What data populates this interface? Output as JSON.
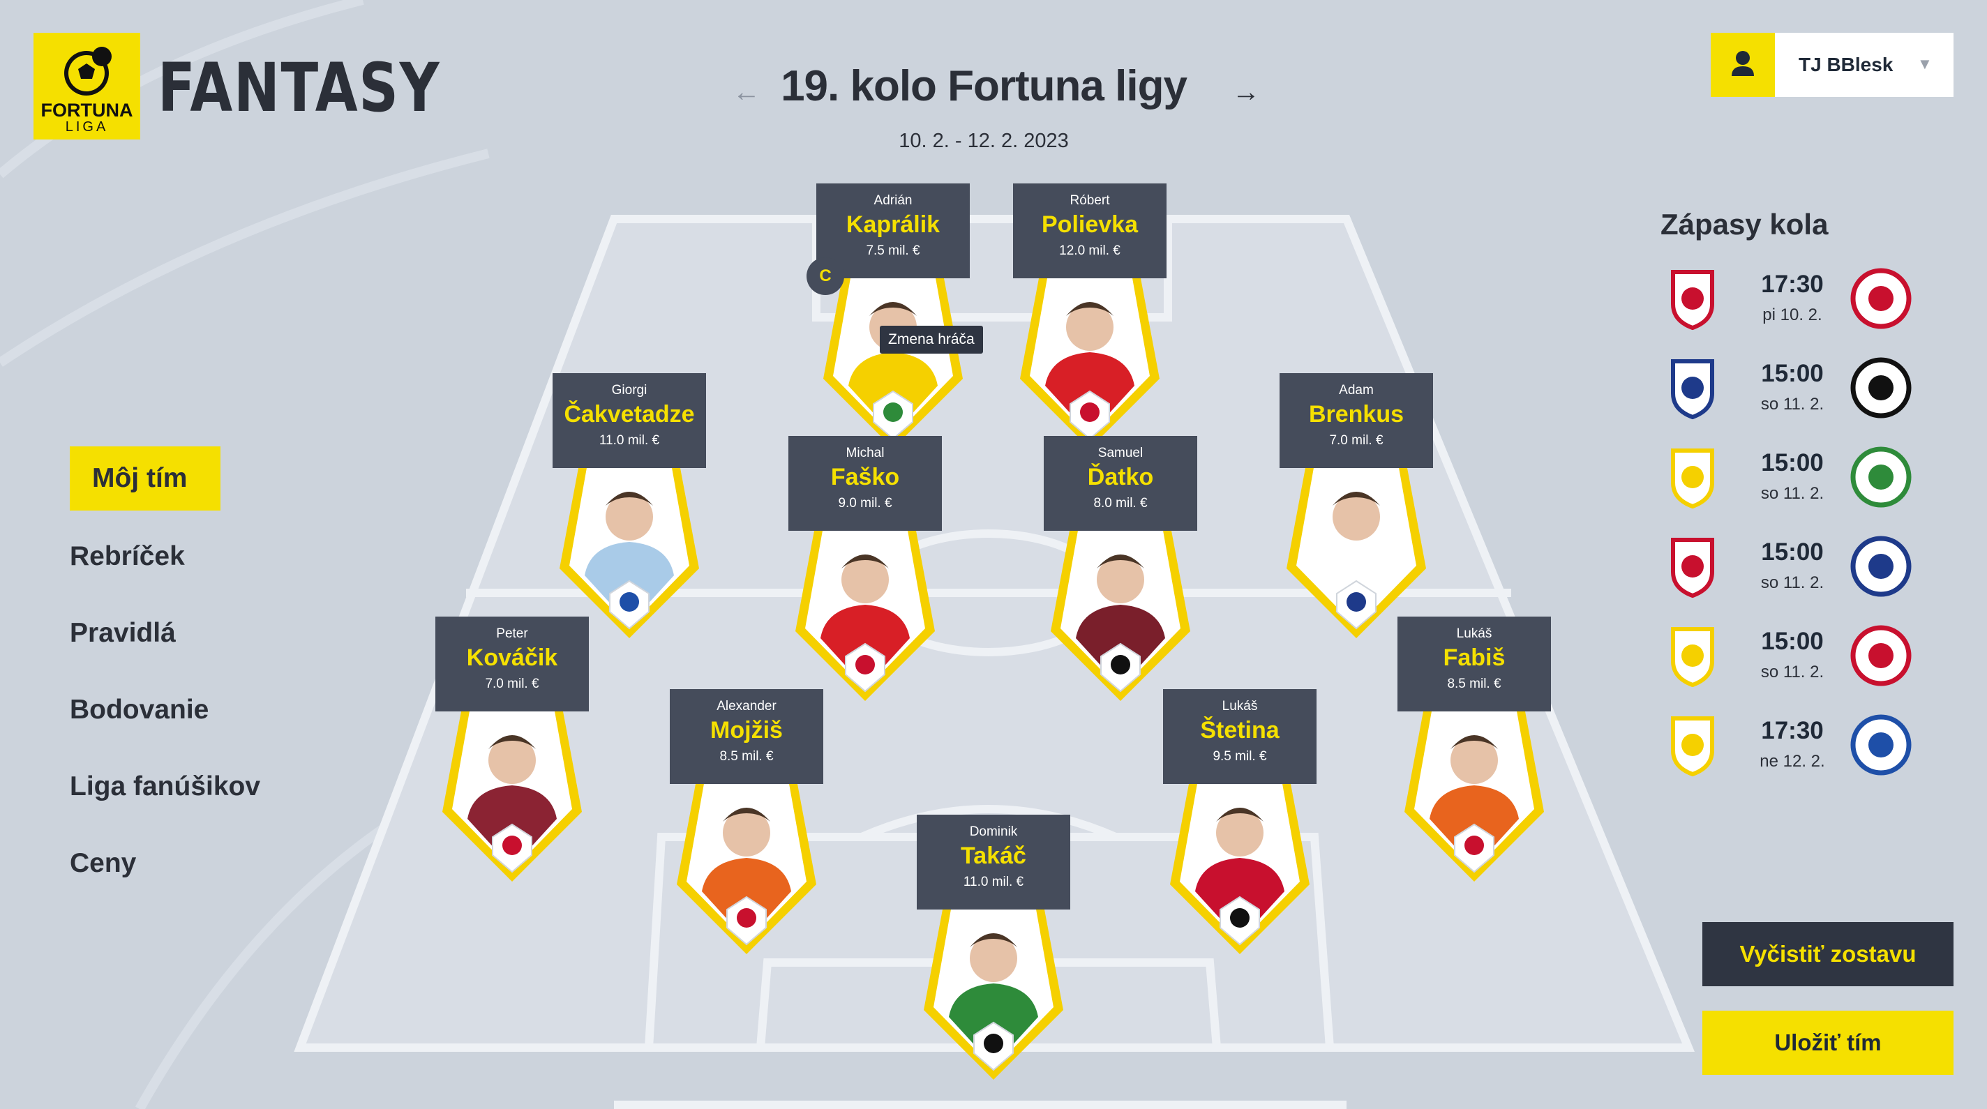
{
  "brand": {
    "logo_line1": "FORTUNA",
    "logo_line2": "LIGA",
    "product": "FANTASY",
    "accent": "#f5e000"
  },
  "round": {
    "title": "19. kolo Fortuna ligy",
    "dates": "10. 2. - 12. 2. 2023",
    "prev_icon": "arrow-left-icon",
    "next_icon": "arrow-right-icon"
  },
  "user": {
    "team_name": "TJ BBlesk",
    "icon": "user-icon",
    "caret": "▼"
  },
  "nav": {
    "items": [
      {
        "label": "Môj tím",
        "active": true
      },
      {
        "label": "Rebríček",
        "active": false
      },
      {
        "label": "Pravidlá",
        "active": false
      },
      {
        "label": "Bodovanie",
        "active": false
      },
      {
        "label": "Liga fanúšikov",
        "active": false
      },
      {
        "label": "Ceny",
        "active": false
      }
    ]
  },
  "fixtures": {
    "title": "Zápasy kola",
    "matches": [
      {
        "time": "17:30",
        "date": "pi 10. 2.",
        "home_color": "#c8102e",
        "away_color": "#c8102e"
      },
      {
        "time": "15:00",
        "date": "so 11. 2.",
        "home_color": "#1e3a8a",
        "away_color": "#111111"
      },
      {
        "time": "15:00",
        "date": "so 11. 2.",
        "home_color": "#f5d000",
        "away_color": "#2e8b3a"
      },
      {
        "time": "15:00",
        "date": "so 11. 2.",
        "home_color": "#c8102e",
        "away_color": "#1e3a8a"
      },
      {
        "time": "15:00",
        "date": "so 11. 2.",
        "home_color": "#f5d000",
        "away_color": "#c8102e"
      },
      {
        "time": "17:30",
        "date": "ne 12. 2.",
        "home_color": "#f5d000",
        "away_color": "#1e4fa8"
      }
    ]
  },
  "players": [
    {
      "first": "Adrián",
      "last": "Kaprálik",
      "price": "7.5 mil. €",
      "kit": "#f5d000",
      "club_color": "#2e8b3a",
      "captain": true
    },
    {
      "first": "Róbert",
      "last": "Polievka",
      "price": "12.0 mil. €",
      "kit": "#d81f26",
      "club_color": "#c8102e"
    },
    {
      "first": "Giorgi",
      "last": "Čakvetadze",
      "price": "11.0 mil. €",
      "kit": "#a9cbe8",
      "club_color": "#1e4fa8"
    },
    {
      "first": "Michal",
      "last": "Faško",
      "price": "9.0 mil. €",
      "kit": "#d81f26",
      "club_color": "#c8102e"
    },
    {
      "first": "Samuel",
      "last": "Ďatko",
      "price": "8.0 mil. €",
      "kit": "#7a1f2b",
      "club_color": "#111111"
    },
    {
      "first": "Adam",
      "last": "Brenkus",
      "price": "7.0 mil. €",
      "kit": "#ffffff",
      "club_color": "#1e3a8a"
    },
    {
      "first": "Peter",
      "last": "Kováčik",
      "price": "7.0 mil. €",
      "kit": "#8b2333",
      "club_color": "#c8102e"
    },
    {
      "first": "Alexander",
      "last": "Mojžiš",
      "price": "8.5 mil. €",
      "kit": "#e8641e",
      "club_color": "#c8102e"
    },
    {
      "first": "Lukáš",
      "last": "Štetina",
      "price": "9.5 mil. €",
      "kit": "#c8102e",
      "club_color": "#111111"
    },
    {
      "first": "Lukáš",
      "last": "Fabiš",
      "price": "8.5 mil. €",
      "kit": "#e8641e",
      "club_color": "#c8102e"
    },
    {
      "first": "Dominik",
      "last": "Takáč",
      "price": "11.0 mil. €",
      "kit": "#2e8b3a",
      "club_color": "#111111"
    }
  ],
  "captain_badge": "C",
  "tooltip": "Zmena hráča",
  "actions": {
    "clear": "Vyčistiť zostavu",
    "save": "Uložiť tím"
  }
}
